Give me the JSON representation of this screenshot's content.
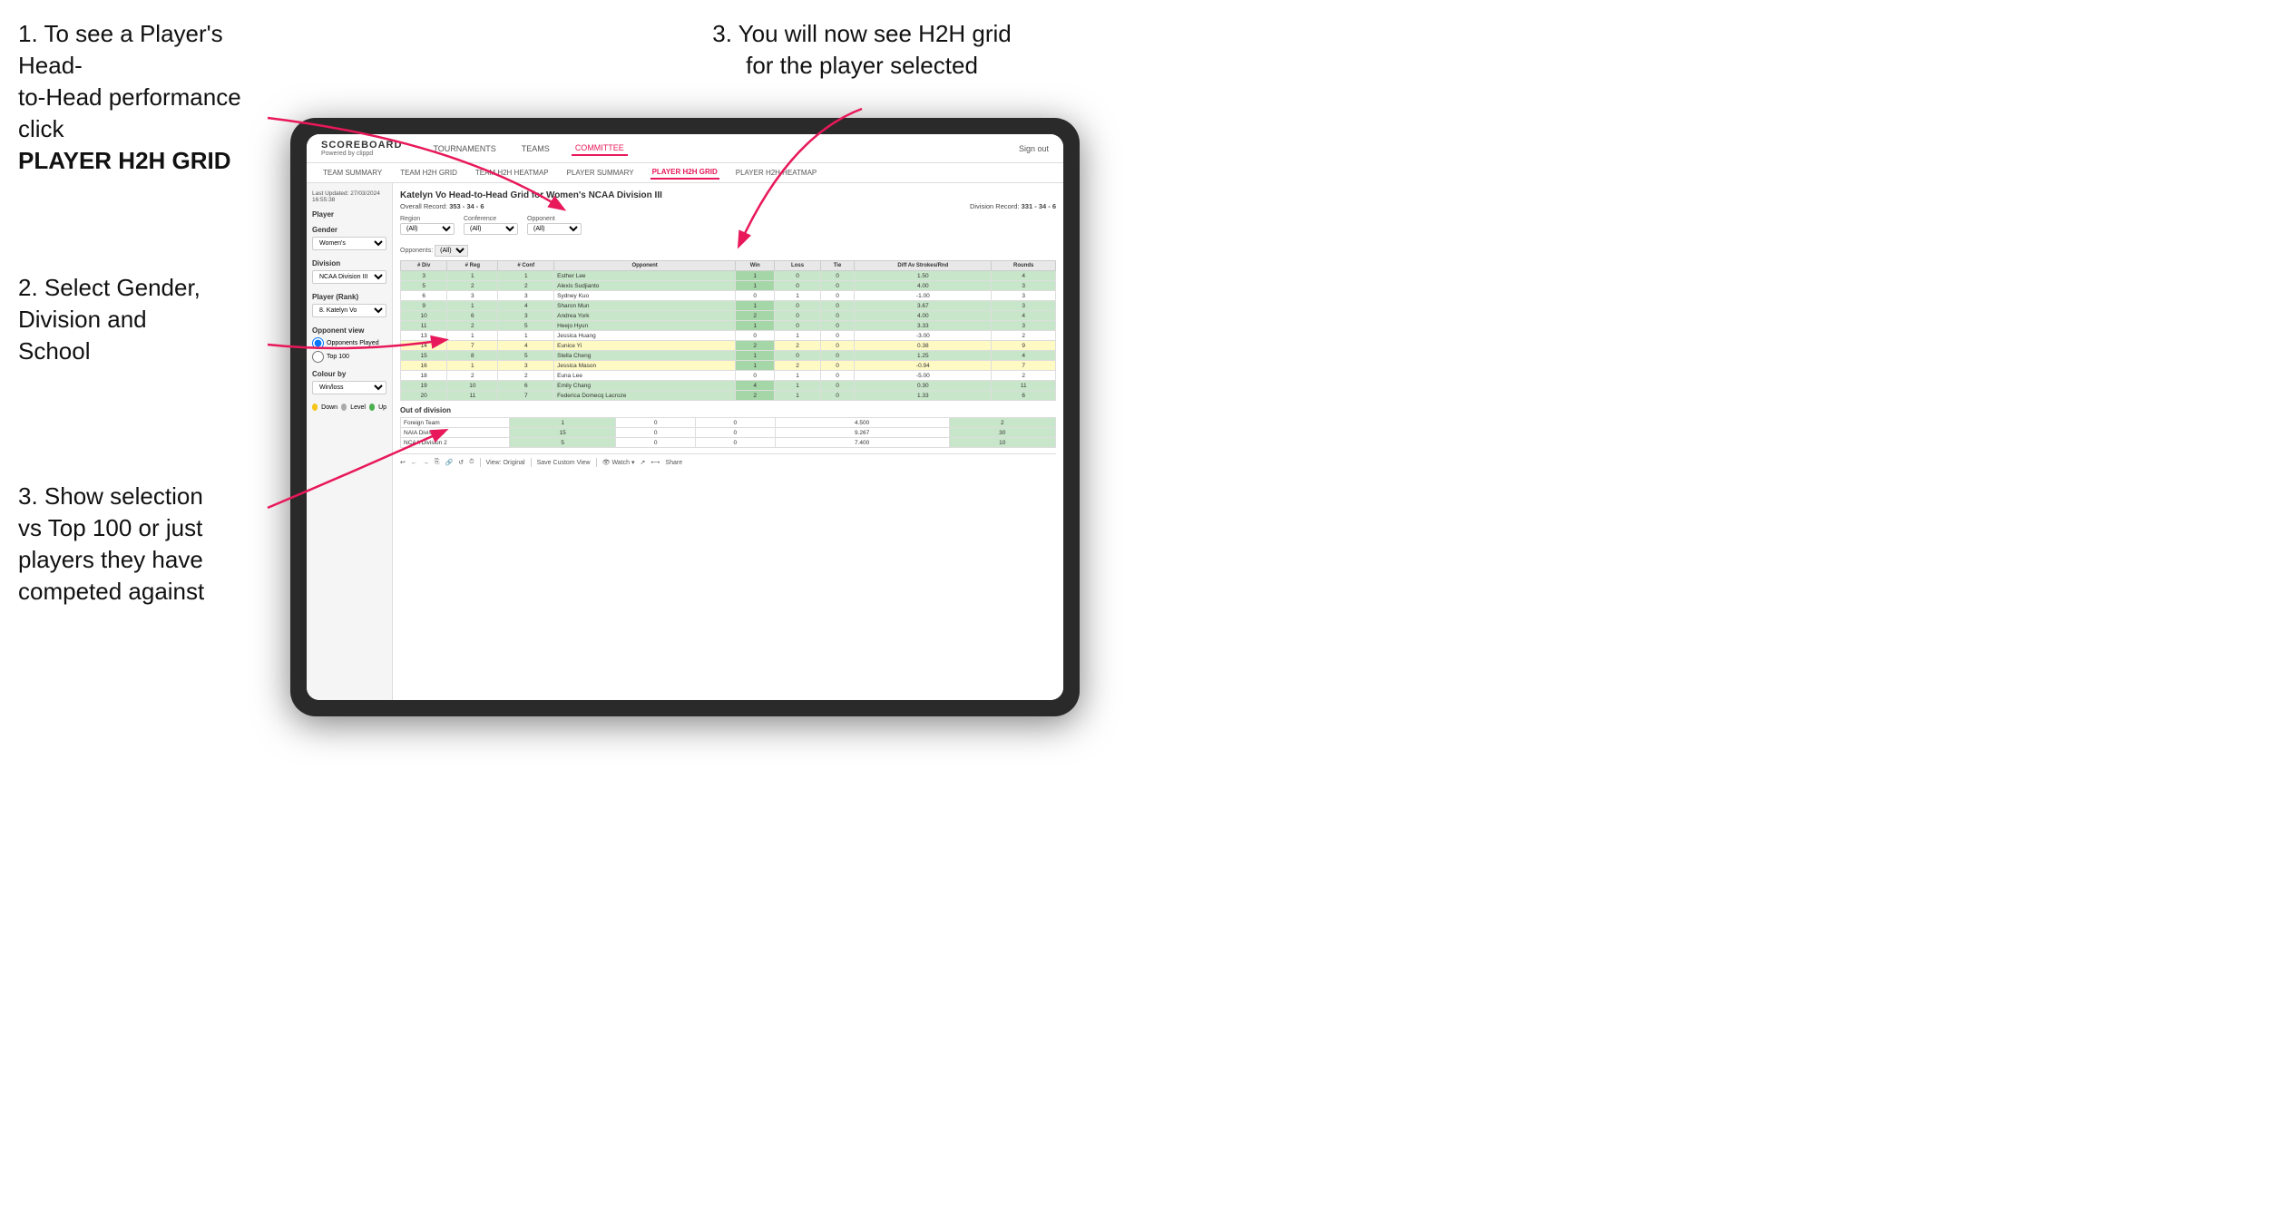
{
  "instructions": {
    "top_left_line1": "1. To see a Player's Head-",
    "top_left_line2": "to-Head performance click",
    "top_left_bold": "PLAYER H2H GRID",
    "middle_left_line1": "2. Select Gender,",
    "middle_left_line2": "Division and",
    "middle_left_line3": "School",
    "bottom_left_line1": "3. Show selection",
    "bottom_left_line2": "vs Top 100 or just",
    "bottom_left_line3": "players they have",
    "bottom_left_line4": "competed against",
    "top_right_line1": "3. You will now see H2H grid",
    "top_right_line2": "for the player selected"
  },
  "navbar": {
    "logo": "SCOREBOARD",
    "logo_sub": "Powered by clippd",
    "nav_items": [
      "TOURNAMENTS",
      "TEAMS",
      "COMMITTEE"
    ],
    "sign_out": "Sign out"
  },
  "sub_navbar": {
    "items": [
      "TEAM SUMMARY",
      "TEAM H2H GRID",
      "TEAM H2H HEATMAP",
      "PLAYER SUMMARY",
      "PLAYER H2H GRID",
      "PLAYER H2H HEATMAP"
    ],
    "active": "PLAYER H2H GRID"
  },
  "left_panel": {
    "last_updated_label": "Last Updated: 27/03/2024",
    "last_updated_time": "16:55:38",
    "player_label": "Player",
    "gender_label": "Gender",
    "gender_value": "Women's",
    "division_label": "Division",
    "division_value": "NCAA Division III",
    "player_rank_label": "Player (Rank)",
    "player_rank_value": "8. Katelyn Vo",
    "opponent_view_label": "Opponent view",
    "opponent_played": "Opponents Played",
    "top_100": "Top 100",
    "colour_by_label": "Colour by",
    "colour_by_value": "Win/loss",
    "legend_down": "Down",
    "legend_level": "Level",
    "legend_up": "Up"
  },
  "grid": {
    "title": "Katelyn Vo Head-to-Head Grid for Women's NCAA Division III",
    "overall_record_label": "Overall Record:",
    "overall_record": "353 - 34 - 6",
    "division_record_label": "Division Record:",
    "division_record": "331 - 34 - 6",
    "opponents_label": "Opponents:",
    "region_label": "Region",
    "conference_label": "Conference",
    "opponent_label": "Opponent",
    "opponents_filter": "(All)",
    "region_filter": "(All)",
    "conference_filter": "(All)",
    "opponent_filter": "(All)",
    "col_headers": [
      "# Div",
      "# Reg",
      "# Conf",
      "Opponent",
      "Win",
      "Loss",
      "Tie",
      "Diff Av Strokes/Rnd",
      "Rounds"
    ],
    "rows": [
      {
        "div": 3,
        "reg": 1,
        "conf": 1,
        "opponent": "Esther Lee",
        "win": 1,
        "loss": 0,
        "tie": 0,
        "diff": 1.5,
        "rounds": 4,
        "color": "green"
      },
      {
        "div": 5,
        "reg": 2,
        "conf": 2,
        "opponent": "Alexis Sudjianto",
        "win": 1,
        "loss": 0,
        "tie": 0,
        "diff": 4.0,
        "rounds": 3,
        "color": "green"
      },
      {
        "div": 6,
        "reg": 3,
        "conf": 3,
        "opponent": "Sydney Kuo",
        "win": 0,
        "loss": 1,
        "tie": 0,
        "diff": -1.0,
        "rounds": 3,
        "color": "white"
      },
      {
        "div": 9,
        "reg": 1,
        "conf": 4,
        "opponent": "Sharon Mun",
        "win": 1,
        "loss": 0,
        "tie": 0,
        "diff": 3.67,
        "rounds": 3,
        "color": "green"
      },
      {
        "div": 10,
        "reg": 6,
        "conf": 3,
        "opponent": "Andrea York",
        "win": 2,
        "loss": 0,
        "tie": 0,
        "diff": 4.0,
        "rounds": 4,
        "color": "green"
      },
      {
        "div": 11,
        "reg": 2,
        "conf": 5,
        "opponent": "Heejo Hyun",
        "win": 1,
        "loss": 0,
        "tie": 0,
        "diff": 3.33,
        "rounds": 3,
        "color": "green"
      },
      {
        "div": 13,
        "reg": 1,
        "conf": 1,
        "opponent": "Jessica Huang",
        "win": 0,
        "loss": 1,
        "tie": 0,
        "diff": -3.0,
        "rounds": 2,
        "color": "white"
      },
      {
        "div": 14,
        "reg": 7,
        "conf": 4,
        "opponent": "Eunice Yi",
        "win": 2,
        "loss": 2,
        "tie": 0,
        "diff": 0.38,
        "rounds": 9,
        "color": "yellow"
      },
      {
        "div": 15,
        "reg": 8,
        "conf": 5,
        "opponent": "Stella Cheng",
        "win": 1,
        "loss": 0,
        "tie": 0,
        "diff": 1.25,
        "rounds": 4,
        "color": "green"
      },
      {
        "div": 16,
        "reg": 1,
        "conf": 3,
        "opponent": "Jessica Mason",
        "win": 1,
        "loss": 2,
        "tie": 0,
        "diff": -0.94,
        "rounds": 7,
        "color": "yellow"
      },
      {
        "div": 18,
        "reg": 2,
        "conf": 2,
        "opponent": "Euna Lee",
        "win": 0,
        "loss": 1,
        "tie": 0,
        "diff": -5.0,
        "rounds": 2,
        "color": "white"
      },
      {
        "div": 19,
        "reg": 10,
        "conf": 6,
        "opponent": "Emily Chang",
        "win": 4,
        "loss": 1,
        "tie": 0,
        "diff": 0.3,
        "rounds": 11,
        "color": "green"
      },
      {
        "div": 20,
        "reg": 11,
        "conf": 7,
        "opponent": "Federica Domecq Lacroze",
        "win": 2,
        "loss": 1,
        "tie": 0,
        "diff": 1.33,
        "rounds": 6,
        "color": "green"
      }
    ],
    "out_of_division_label": "Out of division",
    "out_of_division_rows": [
      {
        "opponent": "Foreign Team",
        "win": 1,
        "loss": 0,
        "tie": 0,
        "diff": 4.5,
        "rounds": 2
      },
      {
        "opponent": "NAIA Division 1",
        "win": 15,
        "loss": 0,
        "tie": 0,
        "diff": 9.267,
        "rounds": 30
      },
      {
        "opponent": "NCAA Division 2",
        "win": 5,
        "loss": 0,
        "tie": 0,
        "diff": 7.4,
        "rounds": 10
      }
    ]
  },
  "toolbar": {
    "items": [
      "↩",
      "←",
      "→",
      "⎘",
      "🔗",
      "↺",
      "⏱",
      "View: Original",
      "Save Custom View",
      "👁 Watch ▾",
      "↗",
      "⟷",
      "Share"
    ]
  }
}
